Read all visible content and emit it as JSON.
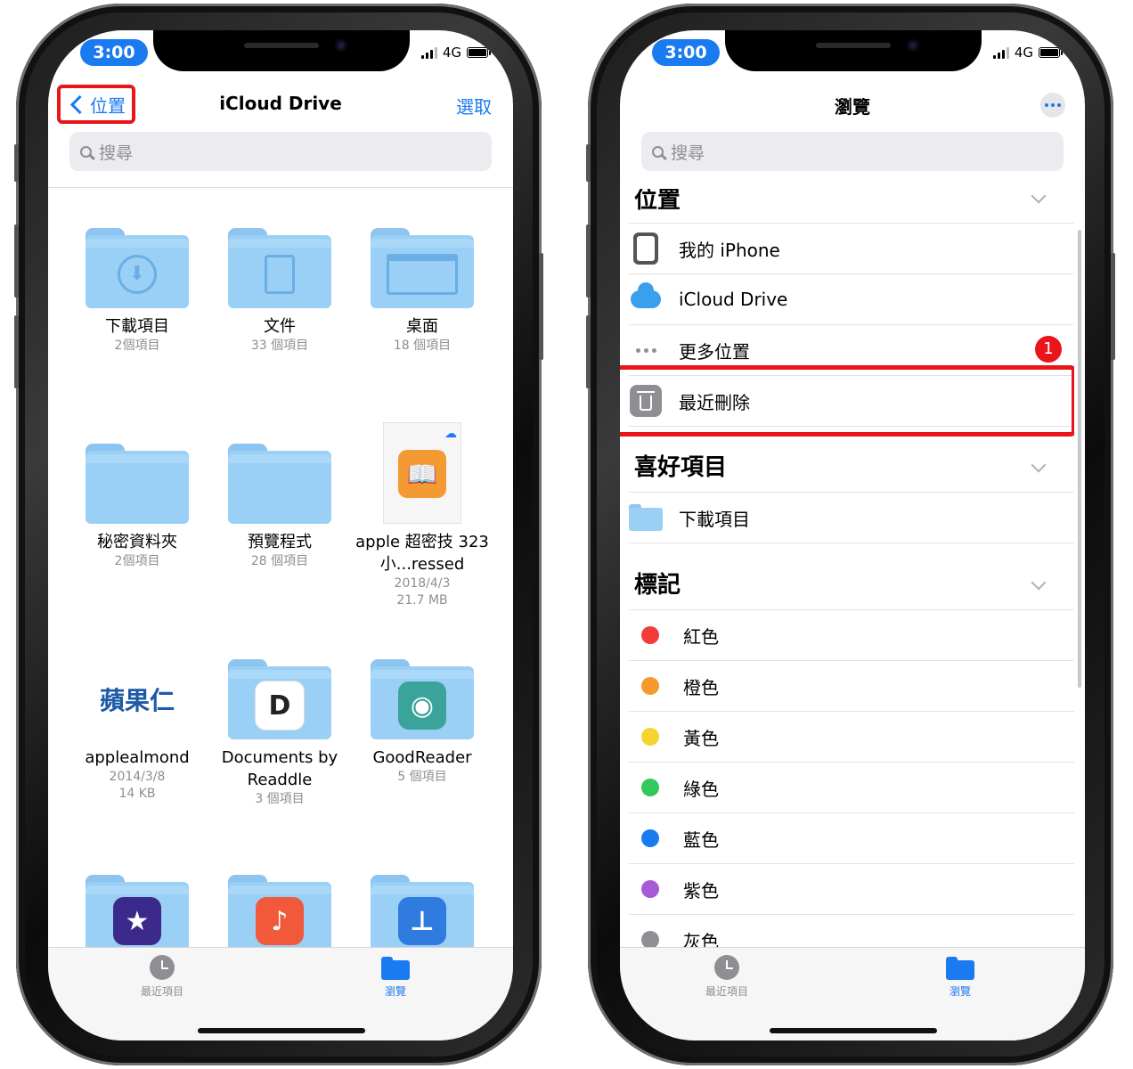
{
  "status": {
    "time": "3:00",
    "network": "4G"
  },
  "left": {
    "nav": {
      "back_label": "位置",
      "title": "iCloud Drive",
      "select_label": "選取"
    },
    "search_placeholder": "搜尋",
    "items": [
      {
        "name": "下載項目",
        "sub": "2個項目",
        "kind": "folder",
        "glyph": "⬇"
      },
      {
        "name": "文件",
        "sub": "33 個項目",
        "kind": "folder",
        "glyph": "📄"
      },
      {
        "name": "桌面",
        "sub": "18 個項目",
        "kind": "folder",
        "glyph": "▭"
      },
      {
        "name": "秘密資料夾",
        "sub": "2個項目",
        "kind": "folder",
        "glyph": ""
      },
      {
        "name": "預覽程式",
        "sub": "28 個項目",
        "kind": "folder",
        "glyph": ""
      },
      {
        "name": "apple 超密技 323 小...ressed",
        "sub": "2018/4/3",
        "sub2": "21.7 MB",
        "kind": "book"
      },
      {
        "name": "applealmond",
        "sub": "2014/3/8",
        "sub2": "14 KB",
        "kind": "logo",
        "logo_text": "蘋果仁"
      },
      {
        "name": "Documents by Readdle",
        "sub": "3 個項目",
        "kind": "app",
        "app_letter": "D",
        "app_color": "#ffffff"
      },
      {
        "name": "GoodReader",
        "sub": "5 個項目",
        "kind": "app",
        "app_letter": "◉",
        "app_color": "#3aa39a"
      },
      {
        "name": "",
        "sub": "",
        "kind": "app",
        "app_letter": "★",
        "app_color": "#3b2a8c"
      },
      {
        "name": "",
        "sub": "",
        "kind": "app",
        "app_letter": "♪",
        "app_color": "#f05a3a"
      },
      {
        "name": "",
        "sub": "",
        "kind": "app",
        "app_letter": "⊥",
        "app_color": "#2f7be0"
      }
    ]
  },
  "right": {
    "nav": {
      "title": "瀏覽"
    },
    "search_placeholder": "搜尋",
    "sections": {
      "locations": "位置",
      "favorites": "喜好項目",
      "tags": "標記"
    },
    "locations": [
      {
        "label": "我的 iPhone",
        "icon": "iphone-icon"
      },
      {
        "label": "iCloud Drive",
        "icon": "icloud-icon"
      },
      {
        "label": "更多位置",
        "icon": "more-icon",
        "badge": "1"
      },
      {
        "label": "最近刪除",
        "icon": "trash-icon"
      }
    ],
    "favorites": [
      {
        "label": "下載項目",
        "icon": "folder-icon"
      }
    ],
    "tags": [
      {
        "label": "紅色",
        "color": "#f23b3b"
      },
      {
        "label": "橙色",
        "color": "#f79a2e"
      },
      {
        "label": "黃色",
        "color": "#f7d32e"
      },
      {
        "label": "綠色",
        "color": "#34c759"
      },
      {
        "label": "藍色",
        "color": "#1a7af0"
      },
      {
        "label": "紫色",
        "color": "#a55bd6"
      },
      {
        "label": "灰色",
        "color": "#8e8e93"
      }
    ]
  },
  "tabbar": {
    "recents": "最近項目",
    "browse": "瀏覽"
  },
  "colors": {
    "accent": "#1a7af0",
    "highlight": "#e8151b"
  }
}
